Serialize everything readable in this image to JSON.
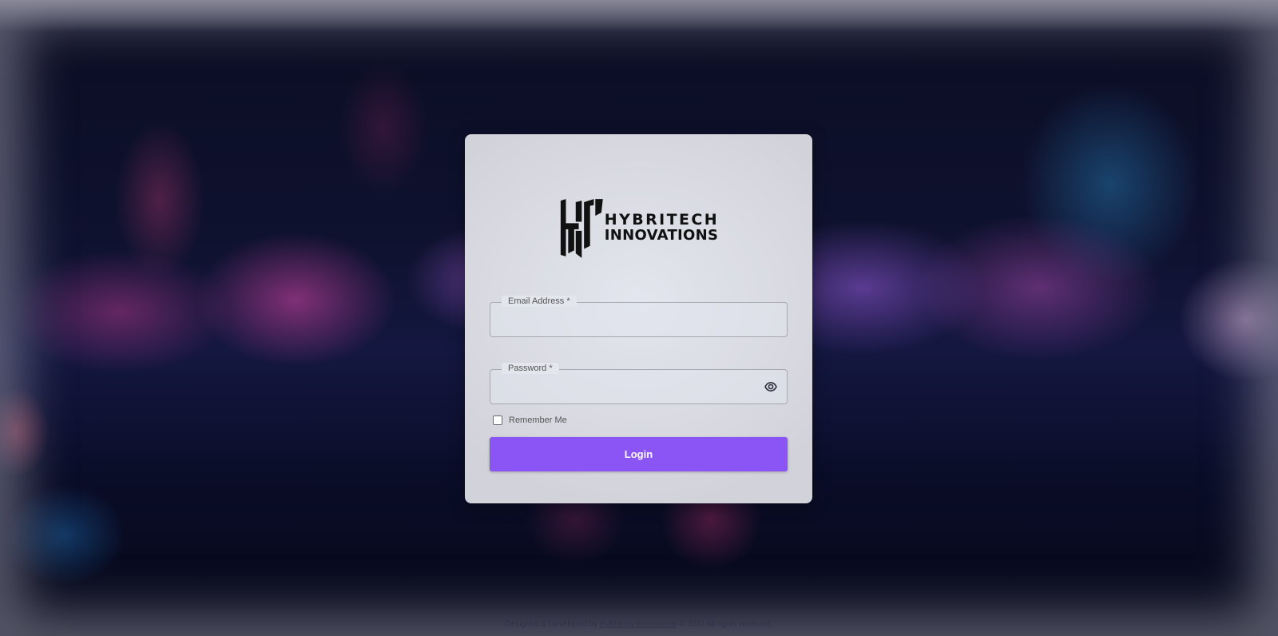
{
  "brand": {
    "line1": "HYBRITECH",
    "line2": "INNOVATIONS"
  },
  "form": {
    "email_label": "Email Address *",
    "email_value": "",
    "password_label": "Password *",
    "password_value": "",
    "remember_label": "Remember Me",
    "remember_checked": false,
    "login_label": "Login"
  },
  "footer": {
    "prefix": "Designed & Developed by",
    "link": "Hybritech Innovations",
    "suffix": "© 2024 All rights reserved."
  },
  "colors": {
    "primary": "#8b55f6",
    "card": "#dcdde5"
  },
  "icons": {
    "password_toggle": "eye-icon"
  }
}
